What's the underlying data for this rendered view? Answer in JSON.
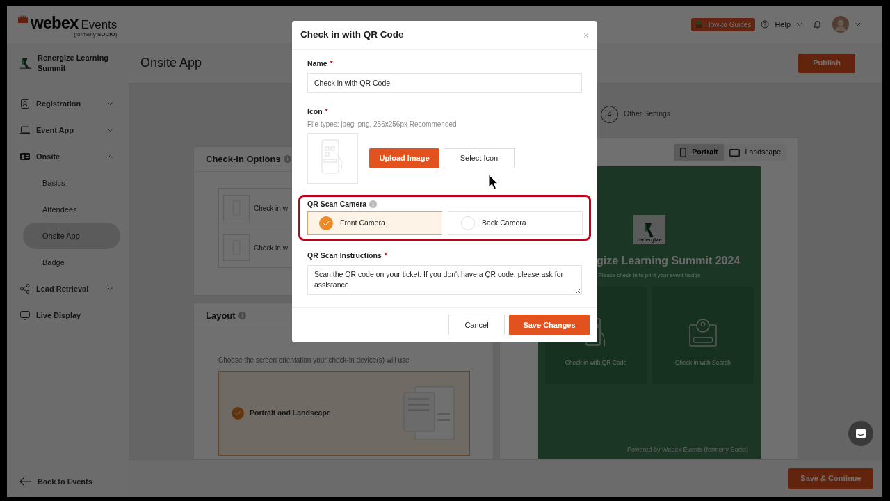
{
  "header": {
    "logo": {
      "brand": "webex",
      "product": "Events",
      "note": "(formerly **SOCIO**)"
    },
    "guides_button": "How-to Guides",
    "help": "Help"
  },
  "sidebar": {
    "event_name": "Renergize Learning Summit",
    "items": [
      {
        "label": "Registration",
        "kind": "group",
        "expanded": false
      },
      {
        "label": "Event App",
        "kind": "group",
        "expanded": false
      },
      {
        "label": "Onsite",
        "kind": "group",
        "expanded": true,
        "children": [
          {
            "label": "Basics",
            "selected": false
          },
          {
            "label": "Attendees",
            "selected": false
          },
          {
            "label": "Onsite App",
            "selected": true
          },
          {
            "label": "Badge",
            "selected": false
          }
        ]
      },
      {
        "label": "Lead Retrieval",
        "kind": "group",
        "expanded": false
      },
      {
        "label": "Live Display",
        "kind": "link"
      }
    ],
    "back": "Back to Events"
  },
  "page": {
    "title": "Onsite App",
    "publish": "Publish",
    "step": {
      "number": "4",
      "label": "Other Settings"
    },
    "checkin_options": {
      "title": "Check-in Options",
      "options": [
        "Check in w",
        "Check in w"
      ]
    },
    "layout": {
      "title": "Layout",
      "hint": "Choose the screen orientation your check-in device(s) will use",
      "choices": [
        {
          "label": "Portrait and Landscape",
          "selected": true
        }
      ]
    },
    "preview": {
      "orientations": [
        {
          "label": "Portrait",
          "selected": true
        },
        {
          "label": "Landscape",
          "selected": false
        }
      ],
      "logo_word": "renergize",
      "title": "gize Learning Summit 2024",
      "subtitle": "Please check in to print your event badge",
      "tiles": [
        "Check in with QR Code",
        "Check in with Search"
      ],
      "footer": "Powered by Webex Events (formerly Socio)"
    },
    "save_continue": "Save & Continue"
  },
  "modal": {
    "title": "Check in with QR Code",
    "close": "×",
    "name": {
      "label": "Name",
      "required_mark": "*",
      "value": "Check in with QR Code"
    },
    "icon": {
      "label": "Icon",
      "required_mark": "*",
      "hint": "File types: jpeg, png, 256x256px Recommended",
      "upload": "Upload Image",
      "select": "Select Icon"
    },
    "camera": {
      "label": "QR Scan Camera",
      "options": [
        {
          "label": "Front Camera",
          "selected": true
        },
        {
          "label": "Back Camera",
          "selected": false
        }
      ]
    },
    "instructions": {
      "label": "QR Scan Instructions",
      "required_mark": "*",
      "value": "Scan the QR code on your ticket. If you don't have a QR code, please ask for assistance."
    },
    "cancel": "Cancel",
    "save": "Save Changes"
  }
}
